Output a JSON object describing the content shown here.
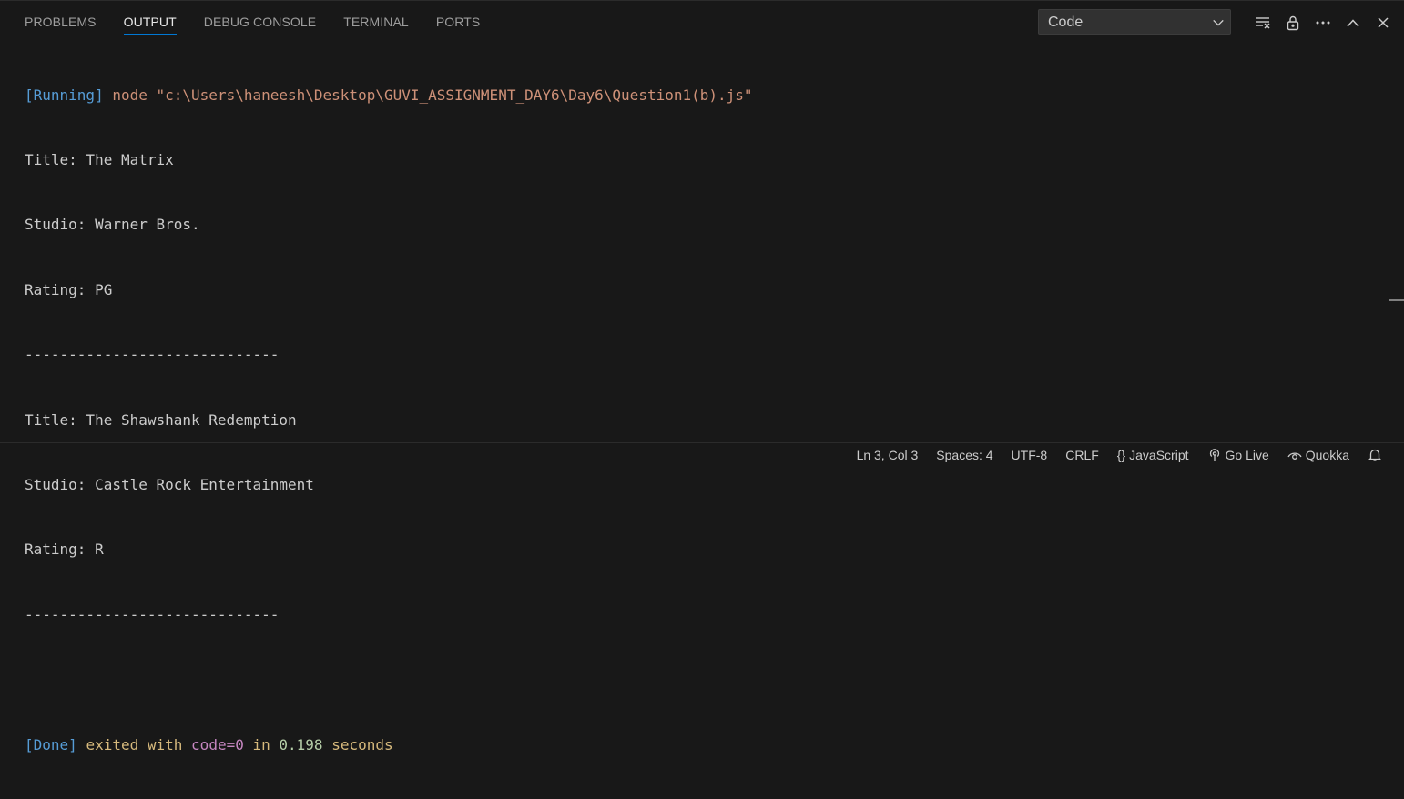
{
  "panel": {
    "tabs": [
      {
        "label": "PROBLEMS",
        "active": false
      },
      {
        "label": "OUTPUT",
        "active": true
      },
      {
        "label": "DEBUG CONSOLE",
        "active": false
      },
      {
        "label": "TERMINAL",
        "active": false
      },
      {
        "label": "PORTS",
        "active": false
      }
    ],
    "channel_select": {
      "value": "Code"
    },
    "actions": [
      "clear-output-icon",
      "lock-icon",
      "more-actions-icon",
      "maximize-panel-icon",
      "close-icon"
    ]
  },
  "output": {
    "running": {
      "tag": "[Running]",
      "command": "node \"c:\\Users\\haneesh\\Desktop\\GUVI_ASSIGNMENT_DAY6\\Day6\\Question1(b).js\""
    },
    "lines": [
      "Title: The Matrix",
      "Studio: Warner Bros.",
      "Rating: PG",
      "-----------------------------",
      "Title: The Shawshank Redemption",
      "Studio: Castle Rock Entertainment",
      "Rating: R",
      "-----------------------------"
    ],
    "done": {
      "tag": "[Done]",
      "text1": "exited with",
      "code": "code=0",
      "text2": "in",
      "time": "0.198",
      "text3": "seconds"
    }
  },
  "statusbar": {
    "position": "Ln 3, Col 3",
    "spaces": "Spaces: 4",
    "encoding": "UTF-8",
    "eol": "CRLF",
    "language_icon": "{}",
    "language": "JavaScript",
    "golive": "Go Live",
    "quokka": "Quokka"
  },
  "colors": {
    "background": "#181818",
    "accent": "#0078d4",
    "running_tag": "#569cd6",
    "command": "#ce9178"
  }
}
